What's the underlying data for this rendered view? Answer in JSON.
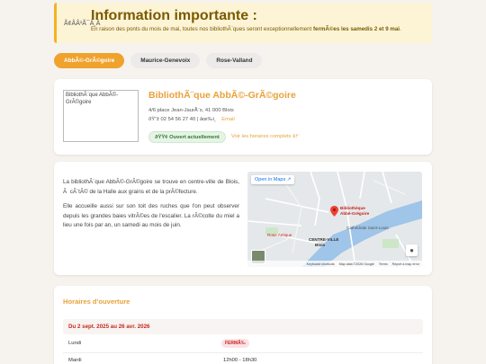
{
  "notice": {
    "icon": "Ã¢ÂÂ¹Ã¯Â¸Â",
    "title": "Information importante :",
    "text_before": "En raison des ponts du mois de mai, toutes nos bibliothÃ¨ques seront exceptionnellement ",
    "text_bold": "fermÃ©es les samedis 2 et 9 mai",
    "text_after": "."
  },
  "tabs": [
    {
      "label": "AbbÃ©-GrÃ©goire",
      "active": true
    },
    {
      "label": "Maurice-Genevoix",
      "active": false
    },
    {
      "label": "Rose-Valland",
      "active": false
    }
  ],
  "library": {
    "photo_alt": "BibliothÃ¨que AbbÃ©-GrÃ©goire",
    "title": "BibliothÃ¨que AbbÃ©-GrÃ©goire",
    "address": "4/6 place Jean-JaurÃ¨s, 41 000 Blois",
    "phone": "ðŸ“ž 02 54 56 27 40",
    "separator": " | ",
    "email_icon": "âœ‰ï¸",
    "email_label": "Email",
    "status": "ðŸŸ¢ Ouvert actuellement",
    "hours_link": "Voir les horaires complets â†’"
  },
  "description": {
    "p1": "La bibliothÃ¨que AbbÃ©-GrÃ©goire se trouve en centre-ville de Blois, Ã  cÃ´tÃ© de la Halle aux grains et de la prÃ©fecture.",
    "p2": "Elle accueille aussi sur son toit des ruches que l'on peut observer depuis les grandes baies vitrÃ©es de l'escalier. La rÃ©colte du miel a lieu une fois par an, un samedi au mois de juin."
  },
  "map": {
    "open_label": "Open in Maps",
    "place_label_1": "Bibliothèque",
    "place_label_2": "Abbé-Grégoire",
    "cathedral": "Cathédrale Saint-Louis",
    "center_1": "CENTRE-VILLE",
    "center_2": "Blois",
    "rose": "Rose Antique",
    "footer_shortcuts": "Keyboard shortcuts",
    "footer_data": "Map data ©2026 Google",
    "footer_terms": "Terms",
    "footer_report": "Report a map error",
    "accent": "#ea4335"
  },
  "hours": {
    "title": "Horaires d'ouverture",
    "period": "Du 2 sept. 2025 au 26 avr. 2026",
    "rows": [
      {
        "day": "Lundi",
        "value": "FERMÃ‰"
      },
      {
        "day": "Mardi",
        "value": "12h00 - 18h30"
      }
    ]
  }
}
